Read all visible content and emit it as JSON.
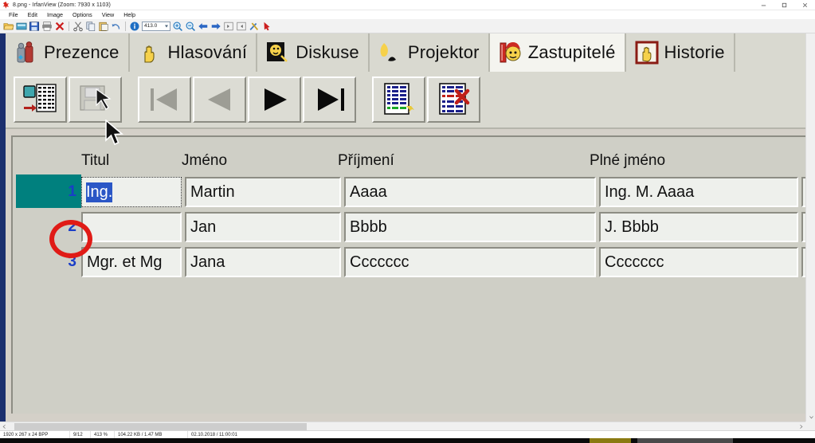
{
  "window": {
    "title": "8.png - IrfanView (Zoom: 7930 x 1103)",
    "app_icon": "irfanview-icon",
    "minimize_label": "Minimize",
    "maximize_label": "Maximize",
    "close_label": "Close"
  },
  "menu": {
    "items": [
      {
        "label": "File"
      },
      {
        "label": "Edit"
      },
      {
        "label": "Image"
      },
      {
        "label": "Options"
      },
      {
        "label": "View"
      },
      {
        "label": "Help"
      }
    ]
  },
  "toolbar": {
    "zoom_value": "413.0",
    "buttons": [
      {
        "name": "open-icon",
        "label": "Open"
      },
      {
        "name": "thumbnails-icon",
        "label": "Thumbnails"
      },
      {
        "name": "save-icon",
        "label": "Save"
      },
      {
        "name": "print-icon",
        "label": "Print"
      },
      {
        "name": "delete-icon",
        "label": "Delete"
      },
      {
        "name": "cut-icon",
        "label": "Cut"
      },
      {
        "name": "copy-icon",
        "label": "Copy"
      },
      {
        "name": "paste-icon",
        "label": "Paste"
      },
      {
        "name": "undo-icon",
        "label": "Undo"
      },
      {
        "name": "info-icon",
        "label": "Information"
      },
      {
        "name": "zoom-in-icon",
        "label": "Zoom In"
      },
      {
        "name": "zoom-out-icon",
        "label": "Zoom Out"
      },
      {
        "name": "previous-image-icon",
        "label": "Previous image"
      },
      {
        "name": "next-image-icon",
        "label": "Next image"
      },
      {
        "name": "first-image-icon",
        "label": "First image"
      },
      {
        "name": "last-image-icon",
        "label": "Last image"
      },
      {
        "name": "settings-icon",
        "label": "Options"
      },
      {
        "name": "exit-icon",
        "label": "Exit"
      }
    ]
  },
  "inner_app": {
    "tabs": [
      {
        "label": "Prezence",
        "icon": "attendance-icon",
        "active": false
      },
      {
        "label": "Hlasování",
        "icon": "hand-vote-icon",
        "active": false
      },
      {
        "label": "Diskuse",
        "icon": "discussion-icon",
        "active": false
      },
      {
        "label": "Projektor",
        "icon": "projector-icon",
        "active": false
      },
      {
        "label": "Zastupitelé",
        "icon": "councillor-icon",
        "active": true
      },
      {
        "label": "Historie",
        "icon": "history-icon",
        "active": false
      }
    ],
    "actions": [
      {
        "name": "export-table-button",
        "label": "Export",
        "enabled": true
      },
      {
        "name": "save-record-button",
        "label": "Save",
        "enabled": false
      },
      {
        "name": "first-record-button",
        "label": "First record",
        "enabled": false
      },
      {
        "name": "previous-record-button",
        "label": "Previous record",
        "enabled": false
      },
      {
        "name": "next-record-button",
        "label": "Next record",
        "enabled": true
      },
      {
        "name": "last-record-button",
        "label": "Last record",
        "enabled": true
      },
      {
        "name": "add-record-button",
        "label": "Add record",
        "enabled": true
      },
      {
        "name": "delete-record-button",
        "label": "Delete record",
        "enabled": true
      }
    ],
    "grid": {
      "columns": [
        {
          "key": "titul",
          "label": "Titul"
        },
        {
          "key": "jmeno",
          "label": "Jméno"
        },
        {
          "key": "prijmeni",
          "label": "Příjmení"
        },
        {
          "key": "plne_jmeno",
          "label": "Plné jméno"
        }
      ],
      "rows": [
        {
          "num": "1",
          "selected": true,
          "titul": "Ing.",
          "titul_highlighted": true,
          "jmeno": "Martin",
          "prijmeni": "Aaaa",
          "plne_jmeno": "Ing. M. Aaaa"
        },
        {
          "num": "2",
          "selected": false,
          "titul": "",
          "titul_highlighted": false,
          "jmeno": "Jan",
          "prijmeni": "Bbbb",
          "plne_jmeno": "J. Bbbb"
        },
        {
          "num": "3",
          "selected": false,
          "titul": "Mgr. et Mg",
          "titul_highlighted": false,
          "jmeno": "Jana",
          "prijmeni": "Ccccccc",
          "plne_jmeno": "Ccccccc"
        }
      ]
    },
    "annotation": {
      "name": "red-circle-highlight",
      "color": "#e01b16",
      "target": "row-1-number"
    }
  },
  "statusbar": {
    "dimensions": "1920 x 267 x 24 BPP",
    "index": "9/12",
    "zoom": "413 %",
    "size": "104.22 KB / 1.47 MB",
    "date": "02.10.2018 / 11:00:01"
  },
  "colors": {
    "accent_teal": "#00807e",
    "selection_blue": "#2a56c6",
    "row_number_blue": "#1a3ec8",
    "annotation_red": "#e01b16",
    "tab_active_bg": "#f4f4ef",
    "chrome_gray": "#d9d9d0"
  }
}
